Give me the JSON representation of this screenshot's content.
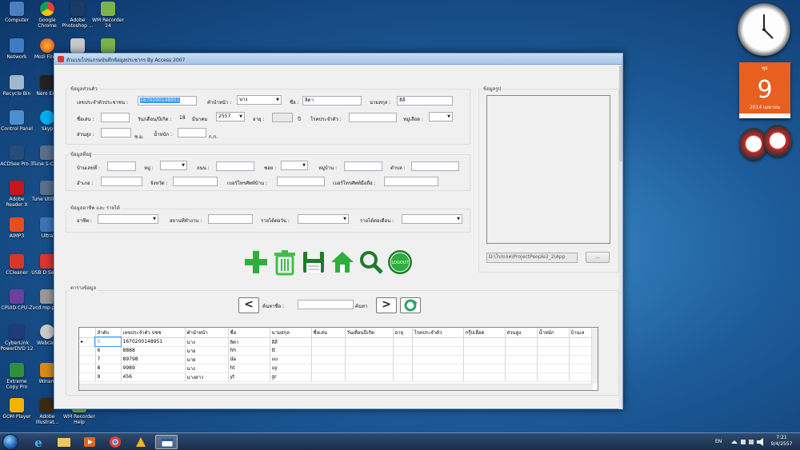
{
  "desktop_icons": [
    {
      "label": "Computer"
    },
    {
      "label": "Google Chrome"
    },
    {
      "label": "Adobe Photoshop ..."
    },
    {
      "label": "WM Recorder 14"
    },
    {
      "label": "Network"
    },
    {
      "label": "Mozi Firefo"
    },
    {
      "label": "Recycle Bin"
    },
    {
      "label": "Nero Exp"
    },
    {
      "label": "Control Panel"
    },
    {
      "label": "Skyp"
    },
    {
      "label": "ACDSee Pro 3"
    },
    {
      "label": "Tune 1-Click"
    },
    {
      "label": "Adobe Reader X"
    },
    {
      "label": "Tune Utilities"
    },
    {
      "label": "AIMP3"
    },
    {
      "label": "Ultra"
    },
    {
      "label": "CCleaner"
    },
    {
      "label": "USB D Securi"
    },
    {
      "label": "CPUID CPU-Z"
    },
    {
      "label": "vcd mp play"
    },
    {
      "label": "CyberLink PowerDVD 12"
    },
    {
      "label": "Webcam"
    },
    {
      "label": "Extreme Copy Pro"
    },
    {
      "label": "Winam"
    },
    {
      "label": "GOM Player"
    },
    {
      "label": "Adobe Illustrat..."
    },
    {
      "label": "WM Recorder Help"
    }
  ],
  "calendar": {
    "weekday": "พุธ",
    "day": "9",
    "month_year": "2014 เมษายน"
  },
  "window": {
    "title": "ตัวแบบโปรแกรมบันทึกข้อมูลประชากร By Access 2007",
    "personal": {
      "group_label": "ข้อมูลส่วนตัว",
      "id_label": "เลขประจำตัวประชาชน :",
      "id_value": "1670200148951",
      "prefix_label": "คำนำหน้า :",
      "prefix_value": "นาง",
      "name_label": "ชื่อ :",
      "name_value": "ลิดา",
      "surname_label": "นามสกุล :",
      "surname_value": "ลิลี",
      "nickname_label": "ชื่อเล่น :",
      "nickname_value": "",
      "birth_label": "วัน/เดือน/ปีเกิด :",
      "birth_day": "18",
      "birth_month": "มีนาคม",
      "birth_year": "2557",
      "age_label": "อายุ :",
      "age_value": "",
      "age_unit": "ปี",
      "disease_label": "โรคประจำตัว :",
      "disease_value": "",
      "blood_label": "หมู่เลือด :",
      "blood_value": "",
      "height_label": "ส่วนสูง :",
      "height_value": "",
      "height_unit": "ซ.ม.",
      "weight_label": "น้ำหนัก :",
      "weight_value": "",
      "weight_unit": "ก.ก."
    },
    "address": {
      "group_label": "ข้อมูลที่อยู่",
      "house_label": "บ้านเลขที่ :",
      "moo_label": "หมู่ :",
      "road_label": "ถนน :",
      "soi_label": "ซอย :",
      "village_label": "หมู่บ้าน :",
      "tambon_label": "ตำบล :",
      "amphoe_label": "อำเภอ :",
      "province_label": "จังหวัด :",
      "home_phone_label": "เบอร์โทรศัพท์บ้าน :",
      "mobile_label": "เบอร์โทรศัพท์มือถือ :"
    },
    "career": {
      "group_label": "ข้อมูลอาชีพ และ รายได้",
      "occupation_label": "อาชีพ :",
      "workplace_label": "สถานที่ทำงาน :",
      "daily_income_label": "รายได้ต่อวัน :",
      "monthly_income_label": "รายได้ต่อเดือน :"
    },
    "photo": {
      "group_label": "ข้อมูลรูป",
      "path_value": "D:\\โปรเจค\\ProjectPeople2_2\\App",
      "browse_label": "..."
    },
    "toolbar": {
      "add_icon": "plus-icon",
      "delete_icon": "trash-icon",
      "save_icon": "floppy-icon",
      "home_icon": "home-icon",
      "search_icon": "magnifier-icon",
      "logout_label": "LOGOUT",
      "colors": {
        "green": "#2eae3d",
        "dark_green": "#1f7a2b"
      }
    },
    "table_section": {
      "group_label": "ตารางข้อมูล",
      "prev_label": "<",
      "next_label": ">",
      "search_name_label": "ค้นหาชื่อ :",
      "search_name_value": "",
      "search_button_label": "ค้นหา"
    },
    "grid": {
      "columns": [
        "ลำดับ",
        "เลขประจำตัว ปชช",
        "คำนำหน้า",
        "ชื่อ",
        "นามสกุล",
        "ชื่อเล่น",
        "วันเดือนปีเกิด",
        "อายุ",
        "โรคประจำตัว",
        "กรุ๊ปเลือด",
        "ส่วนสูง",
        "น้ำหนัก",
        "บ้านเล"
      ],
      "rows": [
        [
          "5",
          "1670200148951",
          "นาง",
          "ลิดา",
          "ลิลี"
        ],
        [
          "6",
          "8888",
          "นาย",
          "hh",
          "tt"
        ],
        [
          "7",
          "89798",
          "นาย",
          "da",
          "uu"
        ],
        [
          "8",
          "9989",
          "นาง",
          "ht",
          "uy"
        ],
        [
          "9",
          "456",
          "นางสาว",
          "yt",
          "gr"
        ]
      ],
      "row_marker": "▸"
    }
  },
  "taskbar": {
    "lang": "EN",
    "time": "7:21",
    "date": "9/4/2557"
  }
}
